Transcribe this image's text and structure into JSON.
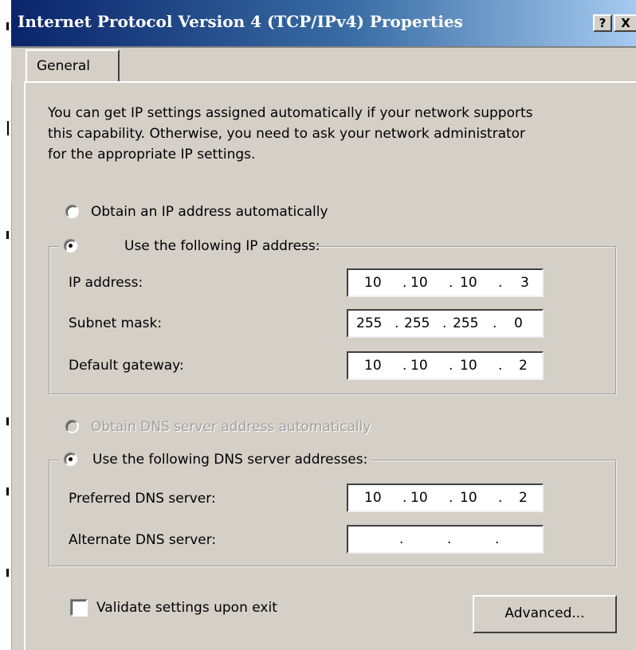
{
  "window": {
    "title": "Internet Protocol Version 4 (TCP/IPv4) Properties",
    "help_label": "?",
    "close_label": "X",
    "active_tab": "General"
  },
  "tabs": [
    {
      "label": "General"
    }
  ],
  "intro_text": [
    "You can get IP settings assigned automatically if your network supports",
    "this capability. Otherwise, you need to ask your network administrator",
    "for the appropriate IP settings."
  ],
  "ip_settings": {
    "auto_option_label": "Obtain an IP address automatically",
    "auto_selected": false,
    "manual_option_label": "Use the following IP address:",
    "manual_selected": true,
    "fields": [
      {
        "label": "IP address:",
        "octets": [
          "10",
          "10",
          "10",
          "3"
        ]
      },
      {
        "label": "Subnet mask:",
        "octets": [
          "255",
          "255",
          "255",
          "0"
        ]
      },
      {
        "label": "Default gateway:",
        "octets": [
          "10",
          "10",
          "10",
          "2"
        ]
      }
    ]
  },
  "dns_settings": {
    "auto_option_label": "Obtain DNS server address automatically",
    "auto_enabled": false,
    "manual_option_label": "Use the following DNS server addresses:",
    "manual_selected": true,
    "fields": [
      {
        "label": "Preferred DNS server:",
        "octets": [
          "10",
          "10",
          "10",
          "2"
        ]
      },
      {
        "label": "Alternate DNS server:",
        "octets": [
          "",
          "",
          "",
          ""
        ]
      }
    ]
  },
  "separator": ".",
  "validate_label": "Validate settings upon exit",
  "validate_checked": false,
  "advanced_button_label": "Advanced...",
  "colors": {
    "titlebar_start": "#0a246a",
    "titlebar_end": "#a6caf0",
    "dialog_bg": "#d4d0c8",
    "disabled_text": "#a0a0a0"
  }
}
